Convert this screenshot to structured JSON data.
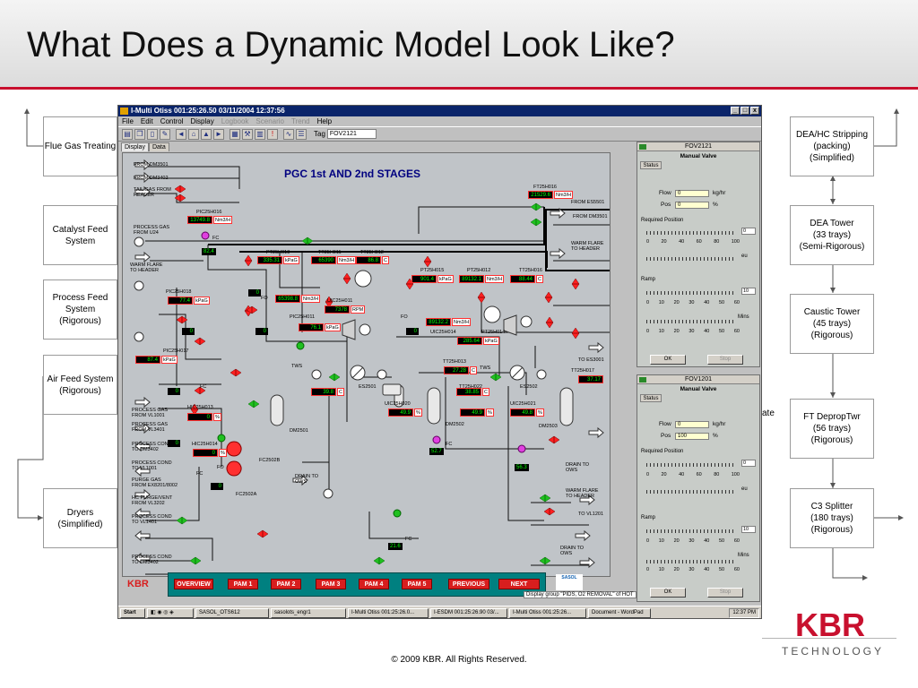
{
  "slide": {
    "title": "What Does a Dynamic Model Look Like?",
    "copyright": "© 2009 KBR. All Rights Reserved.",
    "logo_text": "KBR",
    "logo_subtitle": "TECHNOLOGY",
    "brand_color": "#c8102e"
  },
  "left_boxes": [
    "Flue Gas Treating",
    "Catalyst Feed\nSystem",
    "Process Feed\nSystem\n(Rigorous)",
    "Air Feed System\n(Rigorous)",
    "Dryers\n(Simplified)"
  ],
  "right_boxes": [
    "DEA/HC Stripping\n(packing)\n(Simplified)",
    "DEA Tower\n(33 trays)\n(Semi-Rigorous)",
    "Caustic Tower\n(45 trays)\n(Rigorous)",
    "FT DepropTwr\n(56 trays)\n(Rigorous)",
    "C3 Splitter\n(180 trays)\n(Rigorous)"
  ],
  "floating_label": "ate",
  "window": {
    "title": "I-Multi Otiss 001:25:26.50 03/11/2004  12:37:56",
    "menu": [
      "File",
      "Edit",
      "Control",
      "Display",
      "Logbook",
      "Scenario",
      "Trend",
      "Help"
    ],
    "menu_disabled": [
      "Logbook",
      "Scenario",
      "Trend"
    ],
    "tag_label": "Tag",
    "tag_value": "FOV2121",
    "tabs": [
      "Display",
      "Data"
    ]
  },
  "pid": {
    "title": "PGC 1st AND 2nd STAGES",
    "labels": [
      "FROM DM3501",
      "FROM DM3402",
      "TAIL GAS FROM\nHEADER",
      "PROCESS GAS\nFROM U24",
      "WARM FLARE\nTO HEADER",
      "FROM ES5501",
      "FROM DM3501",
      "WARM FLARE\nTO HEADER",
      "TO ES3001",
      "TWS",
      "TWS",
      "PROCESS GAS\nFROM VL1001",
      "PROCESS GAS\nFROM VL3401",
      "PROCESS COND\nTO DM3402",
      "PROCESS COND\nTO VL1001",
      "PURGE GAS\nFROM EX8201/8002",
      "HC PURGE/VENT\nFROM VL3202",
      "PROCESS COND\nTO VL1401",
      "PROCESS COND\nTO DM3402",
      "DRAIN TO\nOWS",
      "DRAIN TO\nOWS",
      "WARM FLARE\nTO HEADER",
      "TO VL1201",
      "DRAIN TO\nOWS",
      "DM2501",
      "DM2502",
      "DM2503",
      "ES2501",
      "ES2502",
      "FC2502B",
      "FC2502A"
    ],
    "tags": [
      "PIC25H016",
      "PT25H013",
      "TT25H011",
      "TT25H012",
      "PT25H015",
      "PT25H012",
      "TT25H016",
      "FT25H016",
      "PIC25H018",
      "UIC25H011",
      "PIC25H011",
      "PIC25H017",
      "UIC25H014",
      "PT25H014",
      "TT25H013",
      "TT25H022",
      "HIC25H013",
      "HIC25H014",
      "UIC25H021",
      "TT25H017",
      "UIC25H020"
    ],
    "readouts": [
      {
        "value": "13749.8",
        "unit": "Nm3/H"
      },
      {
        "value": "335.31",
        "unit": "kPaG"
      },
      {
        "value": "65390",
        "unit": "Nm3/H"
      },
      {
        "value": "86.8",
        "unit": "C"
      },
      {
        "value": "21529.6",
        "unit": "Nm3/H"
      },
      {
        "value": "901.4",
        "unit": "kPaG"
      },
      {
        "value": "89132.1",
        "unit": "Nm3/H"
      },
      {
        "value": "88.44",
        "unit": "C"
      },
      {
        "value": "77.4",
        "unit": "kPaG"
      },
      {
        "value": "65398.8",
        "unit": "Nm3/H"
      },
      {
        "value": "7378",
        "unit": "RPM"
      },
      {
        "value": "76.1",
        "unit": "kPaG"
      },
      {
        "value": "89132.2",
        "unit": "Nm3/H"
      },
      {
        "value": "285.64",
        "unit": "kPaG"
      },
      {
        "value": "87.4",
        "unit": "kPaG"
      },
      {
        "value": "27.28",
        "unit": "C"
      },
      {
        "value": "39.8",
        "unit": "C"
      },
      {
        "value": "38.85",
        "unit": "C"
      },
      {
        "value": "37.17",
        "unit": "C"
      },
      {
        "value": "49.9",
        "unit": "%"
      },
      {
        "value": "49.9",
        "unit": "%"
      },
      {
        "value": "49.8",
        "unit": "%"
      },
      {
        "value": "0",
        "unit": "%"
      },
      {
        "value": "0",
        "unit": "%"
      }
    ],
    "valve_values": [
      "82.4",
      "0",
      "0",
      "0",
      "0",
      "0",
      "0",
      "0",
      "52.7",
      "56.3",
      "21.6"
    ],
    "fc_label": "FC",
    "fo_label": "FO",
    "nav_kbr": "KBR",
    "nav_buttons": [
      "OVERVIEW",
      "PAM 1",
      "PAM 2",
      "PAM 3",
      "PAM 4",
      "PAM 5",
      "PREVIOUS",
      "NEXT"
    ],
    "status_line": "Display group \"PIDS, O2 REMOVAL\" of HOT",
    "sasol": "SASOL"
  },
  "faceplates": [
    {
      "tag": "FOV2121",
      "mode": "Manual Valve",
      "tab": "Status",
      "flow_label": "Flow",
      "flow_value": "0",
      "flow_unit": "kg/hr",
      "pos_label": "Pos",
      "pos_value": "0",
      "pos_unit": "%",
      "required_label": "Required Position",
      "required_value": "0",
      "scale": [
        "0",
        "20",
        "40",
        "60",
        "80",
        "100"
      ],
      "eu": "eu",
      "ramp_label": "Ramp",
      "ramp_value": "10",
      "ramp_scale": [
        "0",
        "10",
        "20",
        "30",
        "40",
        "50",
        "60"
      ],
      "mins": "Mins",
      "ok": "OK",
      "stop": "Stop"
    },
    {
      "tag": "FOV1201",
      "mode": "Manual Valve",
      "tab": "Status",
      "flow_label": "Flow",
      "flow_value": "0",
      "flow_unit": "kg/hr",
      "pos_label": "Pos",
      "pos_value": "100",
      "pos_unit": "%",
      "required_label": "Required Position",
      "required_value": "0",
      "scale": [
        "0",
        "20",
        "40",
        "60",
        "80",
        "100"
      ],
      "eu": "eu",
      "ramp_label": "Ramp",
      "ramp_value": "10",
      "ramp_scale": [
        "0",
        "10",
        "20",
        "30",
        "40",
        "50",
        "60"
      ],
      "mins": "Mins",
      "ok": "OK",
      "stop": "Stop"
    }
  ],
  "taskbar": {
    "start": "Start",
    "items": [
      "SASOL_OTS612",
      "sasolots_engr1",
      "I-Multi Otiss 001:25:26.0...",
      "I-ESDM 001:25:26.90 03/...",
      "I-Multi Otiss 001:25:26...",
      "Document - WordPad"
    ],
    "clock": "12:37 PM"
  }
}
